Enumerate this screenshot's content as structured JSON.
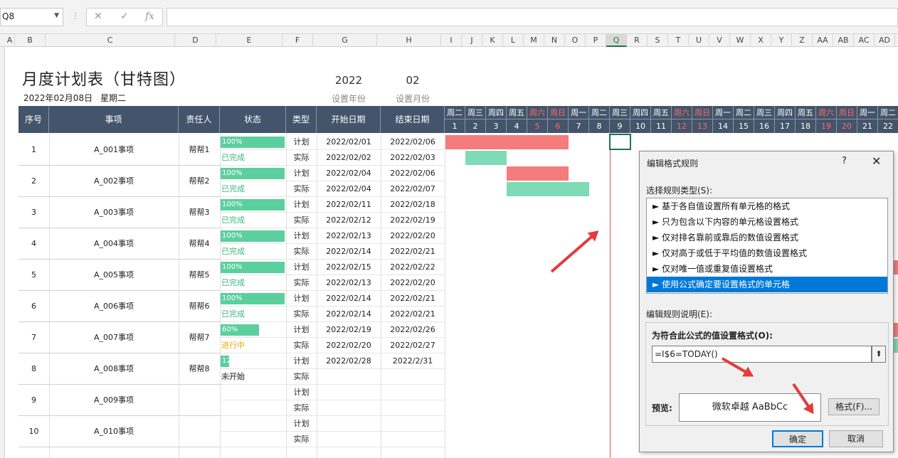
{
  "formula_bar": {
    "name_box": "Q8",
    "cancel": "✕",
    "enter": "✓",
    "fx": "fx",
    "formula": ""
  },
  "columns": [
    "A",
    "B",
    "C",
    "D",
    "E",
    "F",
    "G",
    "H",
    "I",
    "J",
    "K",
    "L",
    "M",
    "N",
    "O",
    "P",
    "Q",
    "R",
    "S",
    "T",
    "U",
    "V",
    "W",
    "X",
    "Y",
    "Z",
    "AA",
    "AB",
    "AC",
    "AD"
  ],
  "sheet": {
    "title": "月度计划表（甘特图）",
    "date": "2022年02月08日",
    "weekday": "星期二",
    "year_value": "2022",
    "year_label": "设置年份",
    "month_value": "02",
    "month_label": "设置月份"
  },
  "headers": {
    "no": "序号",
    "item": "事项",
    "owner": "责任人",
    "status": "状态",
    "type": "类型",
    "start": "开始日期",
    "end": "结束日期"
  },
  "days": [
    {
      "w": "周二",
      "d": "1"
    },
    {
      "w": "周三",
      "d": "2"
    },
    {
      "w": "周四",
      "d": "3"
    },
    {
      "w": "周五",
      "d": "4"
    },
    {
      "w": "周六",
      "d": "5"
    },
    {
      "w": "周日",
      "d": "6"
    },
    {
      "w": "周一",
      "d": "7"
    },
    {
      "w": "周二",
      "d": "8"
    },
    {
      "w": "周三",
      "d": "9"
    },
    {
      "w": "周四",
      "d": "10"
    },
    {
      "w": "周五",
      "d": "11"
    },
    {
      "w": "周六",
      "d": "12"
    },
    {
      "w": "周日",
      "d": "13"
    },
    {
      "w": "周一",
      "d": "14"
    },
    {
      "w": "周二",
      "d": "15"
    },
    {
      "w": "周三",
      "d": "16"
    },
    {
      "w": "周四",
      "d": "17"
    },
    {
      "w": "周五",
      "d": "18"
    },
    {
      "w": "周六",
      "d": "19"
    },
    {
      "w": "周日",
      "d": "20"
    },
    {
      "w": "周一",
      "d": "21"
    },
    {
      "w": "周二",
      "d": "22"
    }
  ],
  "tasks": [
    {
      "no": "1",
      "item": "A_001事项",
      "owner": "帮帮1",
      "progress": "100%",
      "pct": 100,
      "status": "已完成",
      "plan": [
        "2022/02/01",
        "2022/02/06"
      ],
      "actual": [
        "2022/02/02",
        "2022/02/03"
      ]
    },
    {
      "no": "2",
      "item": "A_002事项",
      "owner": "帮帮2",
      "progress": "100%",
      "pct": 100,
      "status": "已完成",
      "plan": [
        "2022/02/04",
        "2022/02/06"
      ],
      "actual": [
        "2022/02/04",
        "2022/02/07"
      ]
    },
    {
      "no": "3",
      "item": "A_003事项",
      "owner": "帮帮3",
      "progress": "100%",
      "pct": 100,
      "status": "已完成",
      "plan": [
        "2022/02/11",
        "2022/02/18"
      ],
      "actual": [
        "2022/02/12",
        "2022/02/19"
      ]
    },
    {
      "no": "4",
      "item": "A_004事项",
      "owner": "帮帮4",
      "progress": "100%",
      "pct": 100,
      "status": "已完成",
      "plan": [
        "2022/02/13",
        "2022/02/20"
      ],
      "actual": [
        "2022/02/14",
        "2022/02/21"
      ]
    },
    {
      "no": "5",
      "item": "A_005事项",
      "owner": "帮帮5",
      "progress": "100%",
      "pct": 100,
      "status": "已完成",
      "plan": [
        "2022/02/15",
        "2022/02/22"
      ],
      "actual": [
        "2022/02/13",
        "2022/02/20"
      ]
    },
    {
      "no": "6",
      "item": "A_006事项",
      "owner": "帮帮6",
      "progress": "100%",
      "pct": 100,
      "status": "已完成",
      "plan": [
        "2022/02/14",
        "2022/02/21"
      ],
      "actual": [
        "2022/02/14",
        "2022/02/21"
      ]
    },
    {
      "no": "7",
      "item": "A_007事项",
      "owner": "帮帮7",
      "progress": "60%",
      "pct": 60,
      "status": "进行中",
      "plan": [
        "2022/02/19",
        "2022/02/26"
      ],
      "actual": [
        "2022/02/20",
        "2022/02/27"
      ]
    },
    {
      "no": "8",
      "item": "A_008事项",
      "owner": "帮帮8",
      "progress": "12%",
      "pct": 12,
      "status": "未开始",
      "plan": [
        "2022/02/28",
        "2022/2/31"
      ],
      "actual": [
        "",
        ""
      ]
    },
    {
      "no": "9",
      "item": "A_009事项",
      "owner": "",
      "progress": "",
      "pct": 0,
      "status": "",
      "plan": [
        "",
        ""
      ],
      "actual": [
        "",
        ""
      ]
    },
    {
      "no": "10",
      "item": "A_010事项",
      "owner": "",
      "progress": "",
      "pct": 0,
      "status": "",
      "plan": [
        "",
        ""
      ],
      "actual": [
        "",
        ""
      ]
    }
  ],
  "type_plan": "计划",
  "type_actual": "实际",
  "status_colors": {
    "已完成": "#3ab57e",
    "进行中": "#f0a500",
    "未开始": "#666666"
  },
  "gantt_colors": {
    "plan": "#f47c7c",
    "actual": "#7ddbb5"
  },
  "dialog": {
    "title": "编辑格式规则",
    "help": "?",
    "close": "✕",
    "select_label": "选择规则类型(S):",
    "rules": [
      "► 基于各自值设置所有单元格的格式",
      "► 只为包含以下内容的单元格设置格式",
      "► 仅对排名靠前或靠后的数值设置格式",
      "► 仅对高于或低于平均值的数值设置格式",
      "► 仅对唯一值或重复值设置格式",
      "► 使用公式确定要设置格式的单元格"
    ],
    "desc_label": "编辑规则说明(E):",
    "formula_label": "为符合此公式的值设置格式(O):",
    "formula": "=I$6=TODAY()",
    "preview_label": "预览:",
    "preview_text": "微软卓越  AaBbCc",
    "format_btn": "格式(F)...",
    "ok": "确定",
    "cancel": "取消"
  }
}
